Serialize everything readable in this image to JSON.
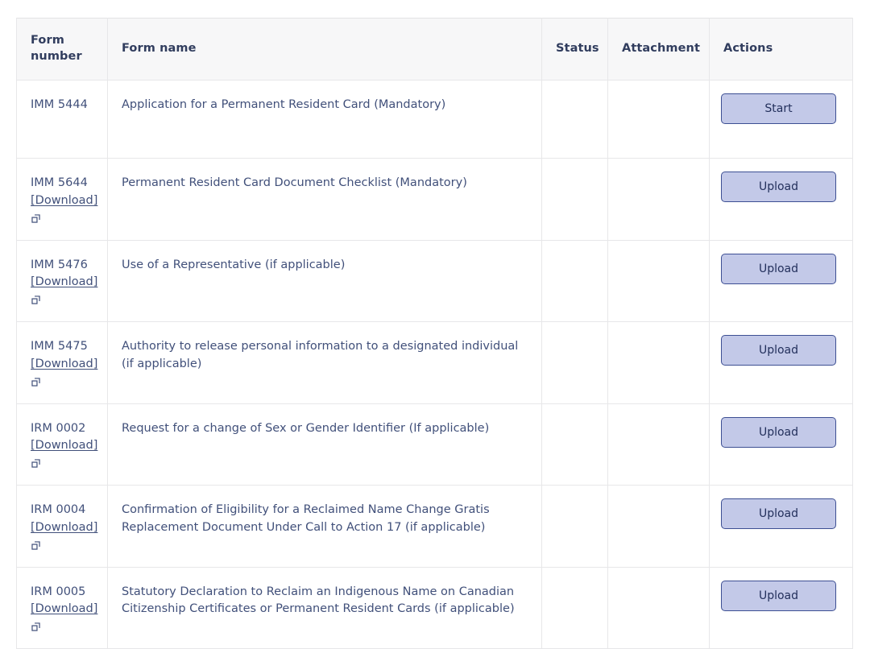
{
  "table": {
    "columns": [
      {
        "key": "form_number",
        "label": "Form number"
      },
      {
        "key": "form_name",
        "label": "Form name"
      },
      {
        "key": "status",
        "label": "Status"
      },
      {
        "key": "attachment",
        "label": "Attachment"
      },
      {
        "key": "actions",
        "label": "Actions"
      }
    ],
    "download_label": "[Download]",
    "external_link_icon": "external-link-icon",
    "rows": [
      {
        "form_number": "IMM 5444",
        "has_download": false,
        "form_name": "Application for a Permanent Resident Card (Mandatory)",
        "status": "",
        "attachment": "",
        "action_label": "Start"
      },
      {
        "form_number": "IMM 5644",
        "has_download": true,
        "form_name": "Permanent Resident Card Document Checklist (Mandatory)",
        "status": "",
        "attachment": "",
        "action_label": "Upload"
      },
      {
        "form_number": "IMM 5476",
        "has_download": true,
        "form_name": "Use of a Representative (if applicable)",
        "status": "",
        "attachment": "",
        "action_label": "Upload"
      },
      {
        "form_number": "IMM 5475",
        "has_download": true,
        "form_name": "Authority to release personal information to a designated individual (if applicable)",
        "status": "",
        "attachment": "",
        "action_label": "Upload"
      },
      {
        "form_number": "IRM 0002",
        "has_download": true,
        "form_name": "Request for a change of Sex or Gender Identifier (If applicable)",
        "status": "",
        "attachment": "",
        "action_label": "Upload"
      },
      {
        "form_number": "IRM 0004",
        "has_download": true,
        "form_name": "Confirmation of Eligibility for a Reclaimed Name Change Gratis Replacement Document Under Call to Action 17 (if applicable)",
        "status": "",
        "attachment": "",
        "action_label": "Upload"
      },
      {
        "form_number": "IRM 0005",
        "has_download": true,
        "form_name": "Statutory Declaration to Reclaim an Indigenous Name on Canadian Citizenship Certificates or Permanent Resident Cards (if applicable)",
        "status": "",
        "attachment": "",
        "action_label": "Upload"
      }
    ]
  },
  "colors": {
    "text": "#41507a",
    "header_text": "#313d5e",
    "header_bg": "#f7f7f8",
    "border": "#e7e7e9",
    "button_bg": "#c3c9e8",
    "button_border": "#3d4f93",
    "button_text": "#23305c"
  }
}
